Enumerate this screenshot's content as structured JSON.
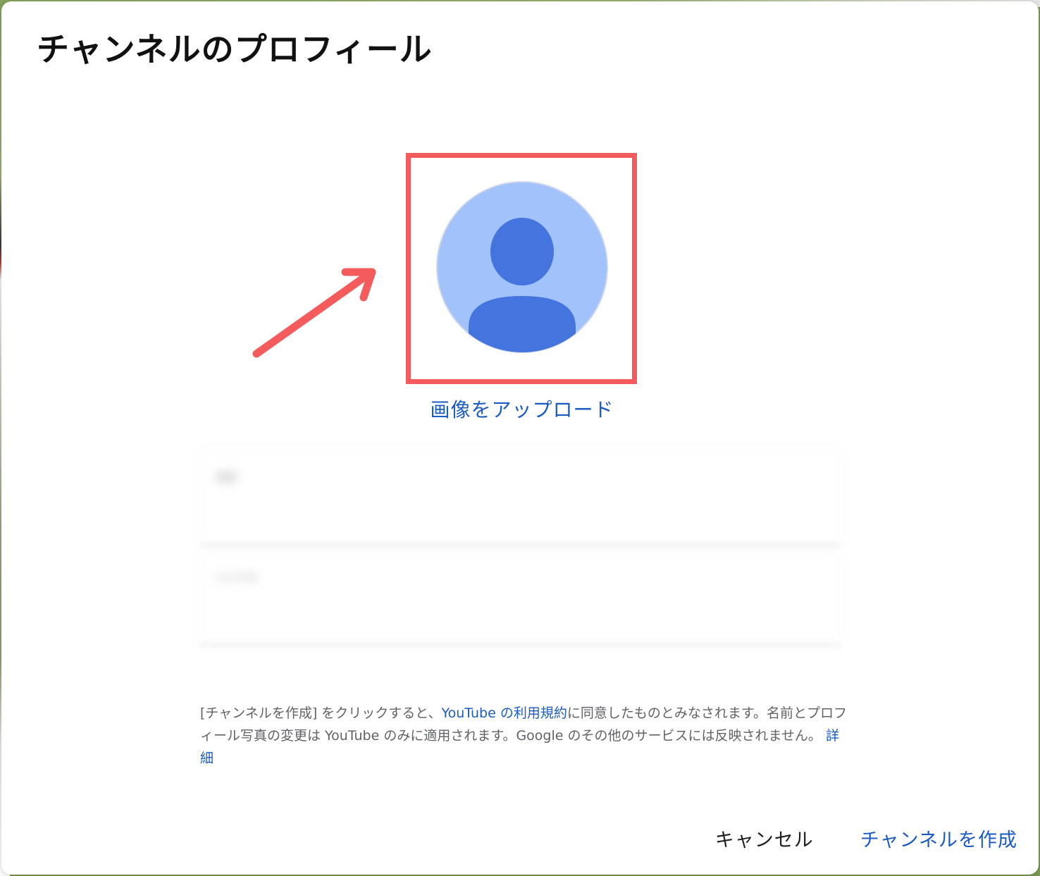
{
  "dialog": {
    "title": "チャンネルのプロフィール",
    "avatar": {
      "icon": "default-avatar-icon",
      "bg_color": "#a1c2fa",
      "figure_color": "#4474dd"
    },
    "upload_label": "画像をアップロード",
    "annotation_color": "#f45b5d",
    "fields": [
      {
        "label": "名前",
        "value": ""
      },
      {
        "label": "ハンドル",
        "value": ""
      }
    ],
    "notice": {
      "part1": "[チャンネルを作成] をクリックすると、",
      "terms_link": "YouTube の利用規約",
      "part2": "に同意したものとみなされます。名前とプロフィール写真の変更は YouTube のみに適用されます。Google のその他のサービスには反映されません。",
      "details_link": "詳細"
    },
    "actions": {
      "cancel_label": "キャンセル",
      "create_label": "チャンネルを作成"
    }
  }
}
